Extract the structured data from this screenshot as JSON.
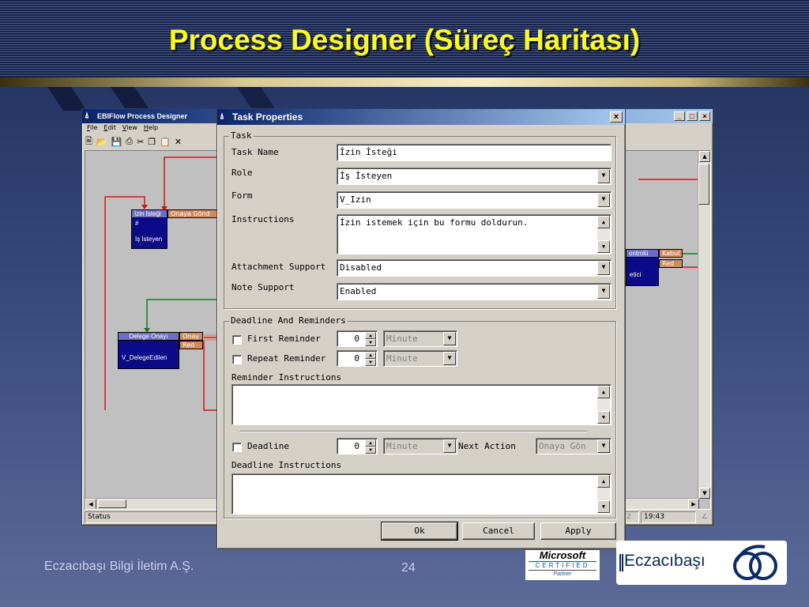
{
  "slide": {
    "title": "Process Designer (Süreç Haritası)",
    "company": "Eczacıbaşı Bilgi İletim A.Ş.",
    "page_number": "24"
  },
  "app": {
    "title": "EBIFlow Process Designer",
    "menu": [
      "File",
      "Edit",
      "View",
      "Help"
    ],
    "status_text": "Status",
    "status_time": "19:43",
    "status_partial": "2",
    "nodes": {
      "izin": {
        "title": "İzin İsteği",
        "port": "Onaya Gönd",
        "body1": "#",
        "body2": "İş İsteyen"
      },
      "delege": {
        "title": "Delege Onayı",
        "port1": "Onay",
        "port2": "Red",
        "body": "V_DelegeEdilen"
      },
      "kontrol": {
        "title": "ontrolü",
        "port1": "Kabul",
        "port2": "Red",
        "body": "etici"
      }
    }
  },
  "dialog": {
    "title": "Task Properties",
    "task_group": "Task",
    "task_name_label": "Task Name",
    "task_name_value": "İzin İsteği",
    "role_label": "Role",
    "role_value": "İş İsteyen",
    "form_label": "Form",
    "form_value": "V_Izin",
    "instructions_label": "Instructions",
    "instructions_value": "İzin istemek için bu formu doldurun.",
    "attachment_label": "Attachment Support",
    "attachment_value": "Disabled",
    "note_label": "Note Support",
    "note_value": "Enabled",
    "deadline_group": "Deadline And Reminders",
    "first_reminder_label": "First Reminder",
    "first_reminder_value": "0",
    "first_reminder_unit": "Minute",
    "repeat_reminder_label": "Repeat Reminder",
    "repeat_reminder_value": "0",
    "repeat_reminder_unit": "Minute",
    "reminder_instructions_label": "Reminder Instructions",
    "deadline_label": "Deadline",
    "deadline_value": "0",
    "deadline_unit": "Minute",
    "next_action_label": "Next Action",
    "next_action_value": "Onaya Gön",
    "deadline_instructions_label": "Deadline Instructions",
    "ok_label": "Ok",
    "cancel_label": "Cancel",
    "apply_label": "Apply"
  },
  "footer": {
    "ms_line1": "Microsoft",
    "ms_line2": "CERTIFIED",
    "ms_line3": "Partner",
    "brand": "Eczacıbaşı"
  },
  "colors": {
    "title_yellow": "#ffff00",
    "titlebar_blue": "#0a246a",
    "node_blue": "#0b0b8a",
    "node_port": "#d28a5a",
    "connector_red": "#e01010",
    "connector_green": "#108010"
  }
}
